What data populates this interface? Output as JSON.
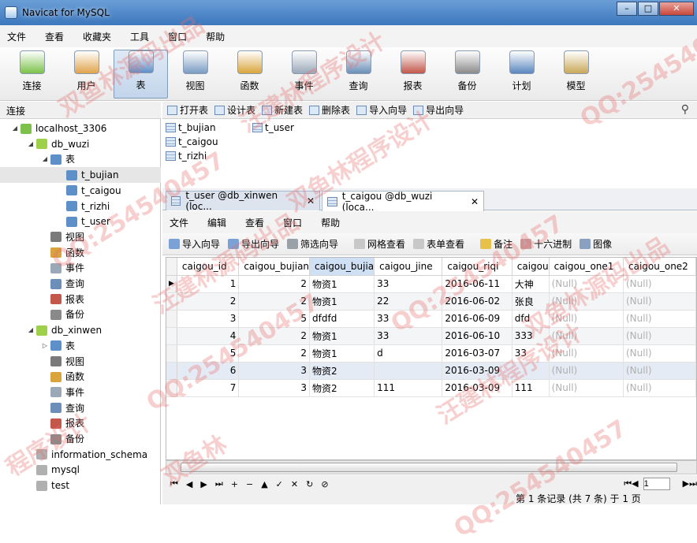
{
  "window": {
    "title": "Navicat for MySQL",
    "min": "–",
    "max": "□",
    "close": "✕"
  },
  "menu": [
    "文件",
    "查看",
    "收藏夹",
    "工具",
    "窗口",
    "帮助"
  ],
  "toolbar": [
    {
      "label": "连接",
      "icon": "connection-icon",
      "color": "#7cc24a"
    },
    {
      "label": "用户",
      "icon": "user-icon",
      "color": "#e0a34a"
    },
    {
      "label": "表",
      "icon": "table-icon",
      "color": "#5d8fc9"
    },
    {
      "label": "视图",
      "icon": "view-icon",
      "color": "#7a9bc2"
    },
    {
      "label": "函数",
      "icon": "function-icon",
      "color": "#d9a43b"
    },
    {
      "label": "事件",
      "icon": "event-icon",
      "color": "#9aa8b8"
    },
    {
      "label": "查询",
      "icon": "query-icon",
      "color": "#6b8fb8"
    },
    {
      "label": "报表",
      "icon": "report-icon",
      "color": "#c2574a"
    },
    {
      "label": "备份",
      "icon": "backup-icon",
      "color": "#8a8a8a"
    },
    {
      "label": "计划",
      "icon": "schedule-icon",
      "color": "#5a86be"
    },
    {
      "label": "模型",
      "icon": "model-icon",
      "color": "#c9a85a"
    }
  ],
  "sidebar": {
    "header": "连接",
    "items": [
      {
        "label": "localhost_3306",
        "icon": "server-icon",
        "color": "#7cc24a",
        "arrow": "◢"
      },
      {
        "label": "db_wuzi",
        "icon": "database-icon",
        "color": "#9fd04a",
        "arrow": "◢"
      },
      {
        "label": "表",
        "icon": "table-folder-icon",
        "color": "#5d8fc9",
        "arrow": "◢"
      },
      {
        "label": "t_bujian",
        "icon": "table-icon",
        "color": "#5d8fc9",
        "arrow": ""
      },
      {
        "label": "t_caigou",
        "icon": "table-icon",
        "color": "#5d8fc9",
        "arrow": ""
      },
      {
        "label": "t_rizhi",
        "icon": "table-icon",
        "color": "#5d8fc9",
        "arrow": ""
      },
      {
        "label": "t_user",
        "icon": "table-icon",
        "color": "#5d8fc9",
        "arrow": ""
      },
      {
        "label": "视图",
        "icon": "view-icon",
        "color": "#7a7a7a",
        "arrow": ""
      },
      {
        "label": "函数",
        "icon": "function-icon",
        "color": "#d9a43b",
        "arrow": ""
      },
      {
        "label": "事件",
        "icon": "event-icon",
        "color": "#9aa8b8",
        "arrow": ""
      },
      {
        "label": "查询",
        "icon": "query-icon",
        "color": "#6b8fb8",
        "arrow": ""
      },
      {
        "label": "报表",
        "icon": "report-icon",
        "color": "#c2574a",
        "arrow": ""
      },
      {
        "label": "备份",
        "icon": "backup-icon",
        "color": "#8a8a8a",
        "arrow": ""
      },
      {
        "label": "db_xinwen",
        "icon": "database-icon",
        "color": "#9fd04a",
        "arrow": "◢"
      },
      {
        "label": "表",
        "icon": "table-folder-icon",
        "color": "#5d8fc9",
        "arrow": "▷"
      },
      {
        "label": "视图",
        "icon": "view-icon",
        "color": "#7a7a7a",
        "arrow": ""
      },
      {
        "label": "函数",
        "icon": "function-icon",
        "color": "#d9a43b",
        "arrow": ""
      },
      {
        "label": "事件",
        "icon": "event-icon",
        "color": "#9aa8b8",
        "arrow": ""
      },
      {
        "label": "查询",
        "icon": "query-icon",
        "color": "#6b8fb8",
        "arrow": ""
      },
      {
        "label": "报表",
        "icon": "report-icon",
        "color": "#c2574a",
        "arrow": ""
      },
      {
        "label": "备份",
        "icon": "backup-icon",
        "color": "#8a8a8a",
        "arrow": ""
      },
      {
        "label": "information_schema",
        "icon": "database-icon",
        "color": "#b0b0b0",
        "arrow": ""
      },
      {
        "label": "mysql",
        "icon": "database-icon",
        "color": "#b0b0b0",
        "arrow": ""
      },
      {
        "label": "test",
        "icon": "database-icon",
        "color": "#b0b0b0",
        "arrow": ""
      }
    ]
  },
  "objbar": [
    "打开表",
    "设计表",
    "新建表",
    "删除表",
    "导入向导",
    "导出向导"
  ],
  "objects": [
    "t_bujian",
    "t_user",
    "t_caigou",
    "t_rizhi"
  ],
  "tabs": [
    "t_user @db_xinwen (loc...",
    "t_caigou @db_wuzi (loca..."
  ],
  "tab_close": "✕",
  "submenu": [
    "文件",
    "编辑",
    "查看",
    "窗口",
    "帮助"
  ],
  "subtool": [
    "导入向导",
    "导出向导",
    "筛选向导",
    "网格查看",
    "表单查看",
    "备注",
    "十六进制",
    "图像"
  ],
  "grid": {
    "columns": [
      "caigou_id",
      "caigou_bujian",
      "caigou_bujia",
      "caigou_jine",
      "caigou_riqi",
      "caigou",
      "caigou_one1",
      "caigou_one2"
    ],
    "rows": [
      [
        "1",
        "2",
        "物资1",
        "33",
        "2016-06-11",
        "大神",
        "(Null)",
        "(Null)"
      ],
      [
        "2",
        "2",
        "物资1",
        "22",
        "2016-06-02",
        "张良",
        "(Null)",
        "(Null)"
      ],
      [
        "3",
        "5",
        "dfdfd",
        "33",
        "2016-06-09",
        "dfd",
        "(Null)",
        "(Null)"
      ],
      [
        "4",
        "2",
        "物资1",
        "33",
        "2016-06-10",
        "333",
        "(Null)",
        "(Null)"
      ],
      [
        "5",
        "2",
        "物资1",
        "d",
        "2016-03-07",
        "33",
        "(Null)",
        "(Null)"
      ],
      [
        "6",
        "3",
        "物资2",
        "",
        "2016-03-09",
        "",
        "(Null)",
        "(Null)"
      ],
      [
        "7",
        "3",
        "物资2",
        "111",
        "2016-03-09",
        "111",
        "(Null)",
        "(Null)"
      ]
    ]
  },
  "nav": [
    "⏮",
    "◀",
    "▶",
    "⏭",
    "+",
    "−",
    "▲",
    "✓",
    "✕",
    "↻",
    "⊘"
  ],
  "pager": {
    "page": "1"
  },
  "status": "第 1 条记录 (共 7 条) 于 1 页",
  "watermarks": [
    "双鱼林源码出品",
    "汪建林程序设计",
    "QQ:254540457",
    "双鱼林程序设计",
    "QQ:254540457",
    "汪建林源码出品",
    "QQ:254540457",
    "双鱼林源码出品",
    "QQ:254540457",
    "汪建林程序设计",
    "程序设计",
    "双鱼林",
    "QQ:254540457"
  ]
}
